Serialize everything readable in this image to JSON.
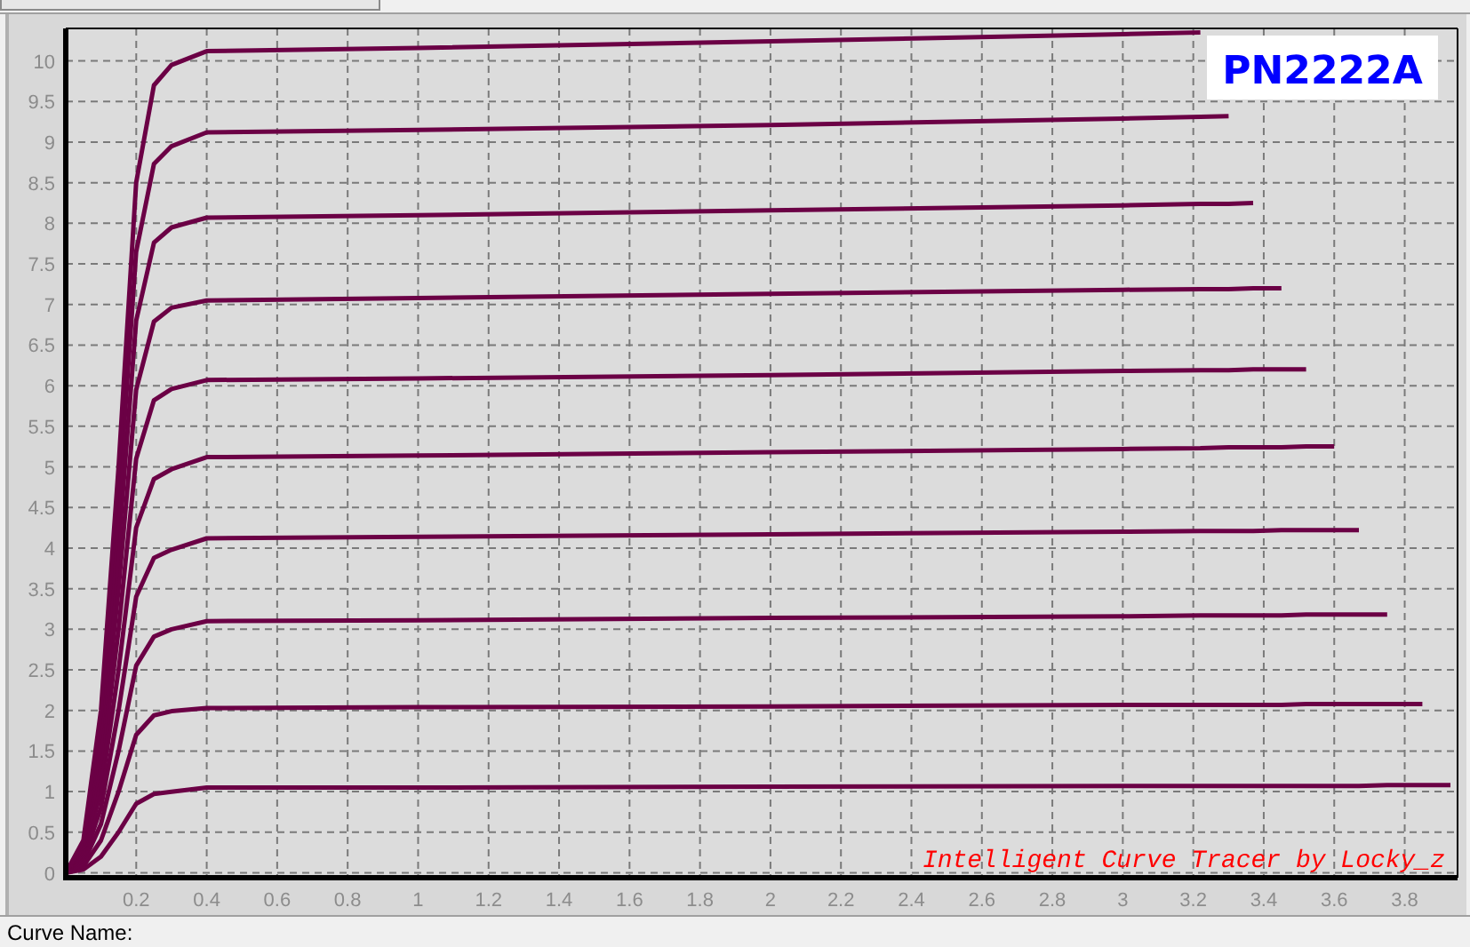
{
  "chart": {
    "chart_data": {
      "type": "line",
      "title": "PN2222A",
      "x": [
        0,
        0.05,
        0.1,
        0.15,
        0.2,
        0.25,
        0.3,
        0.4,
        1,
        2,
        3,
        3.22,
        3.3,
        3.37,
        3.45,
        3.52,
        3.6,
        3.67,
        3.75,
        3.85,
        3.93
      ],
      "series": [
        {
          "color": "#6b0045",
          "values": [
            0,
            0.04,
            0.2,
            0.5,
            0.85,
            0.97,
            1.0,
            1.05,
            1.05,
            1.06,
            1.07,
            1.07,
            1.07,
            1.07,
            1.07,
            1.07,
            1.07,
            1.07,
            1.08,
            1.08,
            1.08
          ]
        },
        {
          "color": "#6b0045",
          "values": [
            0,
            0.08,
            0.4,
            1.0,
            1.7,
            1.94,
            1.99,
            2.03,
            2.04,
            2.05,
            2.07,
            2.07,
            2.07,
            2.07,
            2.07,
            2.08,
            2.08,
            2.08,
            2.08,
            2.08,
            null
          ]
        },
        {
          "color": "#6b0045",
          "values": [
            0,
            0.12,
            0.6,
            1.5,
            2.55,
            2.91,
            3.0,
            3.1,
            3.11,
            3.14,
            3.16,
            3.17,
            3.17,
            3.17,
            3.17,
            3.18,
            3.18,
            3.18,
            3.18,
            null,
            null
          ]
        },
        {
          "color": "#6b0045",
          "values": [
            0,
            0.16,
            0.8,
            2.0,
            3.4,
            3.88,
            3.98,
            4.12,
            4.14,
            4.17,
            4.2,
            4.21,
            4.21,
            4.21,
            4.22,
            4.22,
            4.22,
            4.22,
            null,
            null,
            null
          ]
        },
        {
          "color": "#6b0045",
          "values": [
            0,
            0.2,
            1.0,
            2.5,
            4.25,
            4.85,
            4.97,
            5.12,
            5.14,
            5.18,
            5.22,
            5.23,
            5.24,
            5.24,
            5.24,
            5.25,
            5.25,
            null,
            null,
            null,
            null
          ]
        },
        {
          "color": "#6b0045",
          "values": [
            0,
            0.24,
            1.2,
            3.0,
            5.1,
            5.82,
            5.96,
            6.07,
            6.09,
            6.13,
            6.18,
            6.19,
            6.19,
            6.2,
            6.2,
            6.2,
            null,
            null,
            null,
            null,
            null
          ]
        },
        {
          "color": "#6b0045",
          "values": [
            0,
            0.28,
            1.4,
            3.5,
            5.95,
            6.79,
            6.96,
            7.05,
            7.08,
            7.13,
            7.18,
            7.19,
            7.19,
            7.2,
            7.2,
            null,
            null,
            null,
            null,
            null,
            null
          ]
        },
        {
          "color": "#6b0045",
          "values": [
            0,
            0.32,
            1.6,
            4.0,
            6.8,
            7.76,
            7.95,
            8.07,
            8.1,
            8.16,
            8.22,
            8.24,
            8.24,
            8.25,
            null,
            null,
            null,
            null,
            null,
            null,
            null
          ]
        },
        {
          "color": "#6b0045",
          "values": [
            0,
            0.36,
            1.8,
            4.5,
            7.65,
            8.73,
            8.95,
            9.12,
            9.15,
            9.21,
            9.29,
            9.31,
            9.32,
            null,
            null,
            null,
            null,
            null,
            null,
            null,
            null
          ]
        },
        {
          "color": "#6b0045",
          "values": [
            0,
            0.4,
            2.0,
            5.0,
            8.5,
            9.7,
            9.95,
            10.12,
            10.16,
            10.24,
            10.33,
            10.35,
            null,
            null,
            null,
            null,
            null,
            null,
            null,
            null,
            null
          ]
        }
      ],
      "grid": true,
      "xlim": [
        0,
        3.95
      ],
      "ylim": [
        -0.06,
        10.4
      ],
      "xticks": [
        0.2,
        0.4,
        0.6,
        0.8,
        1,
        1.2,
        1.4,
        1.6,
        1.8,
        2,
        2.2,
        2.4,
        2.6,
        2.8,
        3,
        3.2,
        3.4,
        3.6,
        3.8
      ],
      "yticks": [
        0,
        0.5,
        1,
        1.5,
        2,
        2.5,
        3,
        3.5,
        4,
        4.5,
        5,
        5.5,
        6,
        6.5,
        7,
        7.5,
        8,
        8.5,
        9,
        9.5,
        10
      ],
      "annotations": [
        {
          "text": "Intelligent Curve Tracer by Locky_z"
        }
      ]
    }
  },
  "status_bar": {
    "label": "Curve Name:"
  }
}
